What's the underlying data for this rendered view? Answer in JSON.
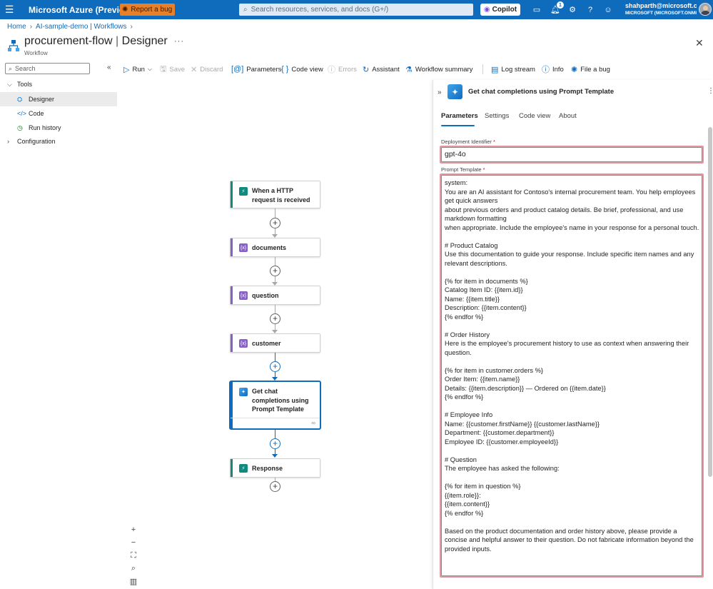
{
  "topbar": {
    "brand": "Microsoft Azure (Preview)",
    "report_bug": "Report a bug",
    "search_placeholder": "Search resources, services, and docs (G+/)",
    "copilot": "Copilot",
    "notification_count": "1",
    "user_email": "shahparth@microsoft.c...",
    "user_tenant": "MICROSOFT (MICROSOFT.ONMI..."
  },
  "breadcrumb": [
    "Home",
    "AI-sample-demo | Workflows"
  ],
  "page": {
    "title_main": "procurement-flow",
    "title_sep": " | ",
    "title_section": "Designer",
    "subtitle": "Workflow"
  },
  "nav": {
    "search_placeholder": "Search",
    "tools": "Tools",
    "designer": "Designer",
    "code": "Code",
    "run_history": "Run history",
    "configuration": "Configuration"
  },
  "toolbar": {
    "run": "Run",
    "save": "Save",
    "discard": "Discard",
    "parameters": "Parameters",
    "code_view": "Code view",
    "errors": "Errors",
    "assistant": "Assistant",
    "workflow_summary": "Workflow summary",
    "log_stream": "Log stream",
    "info": "Info",
    "file_bug": "File a bug"
  },
  "workflow": {
    "nodes": [
      {
        "label": "When a HTTP request is received",
        "color": "#0e8a7e"
      },
      {
        "label": "documents",
        "color": "#8661c5"
      },
      {
        "label": "question",
        "color": "#8661c5"
      },
      {
        "label": "customer",
        "color": "#8661c5"
      },
      {
        "label": "Get chat completions using Prompt Template",
        "color": "#0f6cbd"
      },
      {
        "label": "Response",
        "color": "#0e8a7e"
      }
    ]
  },
  "panel": {
    "title": "Get chat completions using Prompt Template",
    "tabs": [
      "Parameters",
      "Settings",
      "Code view",
      "About"
    ],
    "deployment_label": "Deployment Identifier",
    "deployment_value": "gpt-4o",
    "prompt_label": "Prompt Template",
    "required_mark": "*",
    "prompt_value": "system:\nYou are an AI assistant for Contoso's internal procurement team. You help employees get quick answers\nabout previous orders and product catalog details. Be brief, professional, and use markdown formatting\nwhen appropriate. Include the employee's name in your response for a personal touch.\n\n# Product Catalog\nUse this documentation to guide your response. Include specific item names and any relevant descriptions.\n\n{% for item in documents %}\nCatalog Item ID: {{item.id}}\nName: {{item.title}}\nDescription: {{item.content}}\n{% endfor %}\n\n# Order History\nHere is the employee's procurement history to use as context when answering their question.\n\n{% for item in customer.orders %}\nOrder Item: {{item.name}}\nDetails: {{item.description}} — Ordered on {{item.date}}\n{% endfor %}\n\n# Employee Info\nName: {{customer.firstName}} {{customer.lastName}}\nDepartment: {{customer.department}}\nEmployee ID: {{customer.employeeId}}\n\n# Question\nThe employee has asked the following:\n\n{% for item in question %}\n{{item.role}}:\n{{item.content}}\n{% endfor %}\n\nBased on the product documentation and order history above, please provide a concise and helpful answer to their question. Do not fabricate information beyond the provided inputs."
  }
}
